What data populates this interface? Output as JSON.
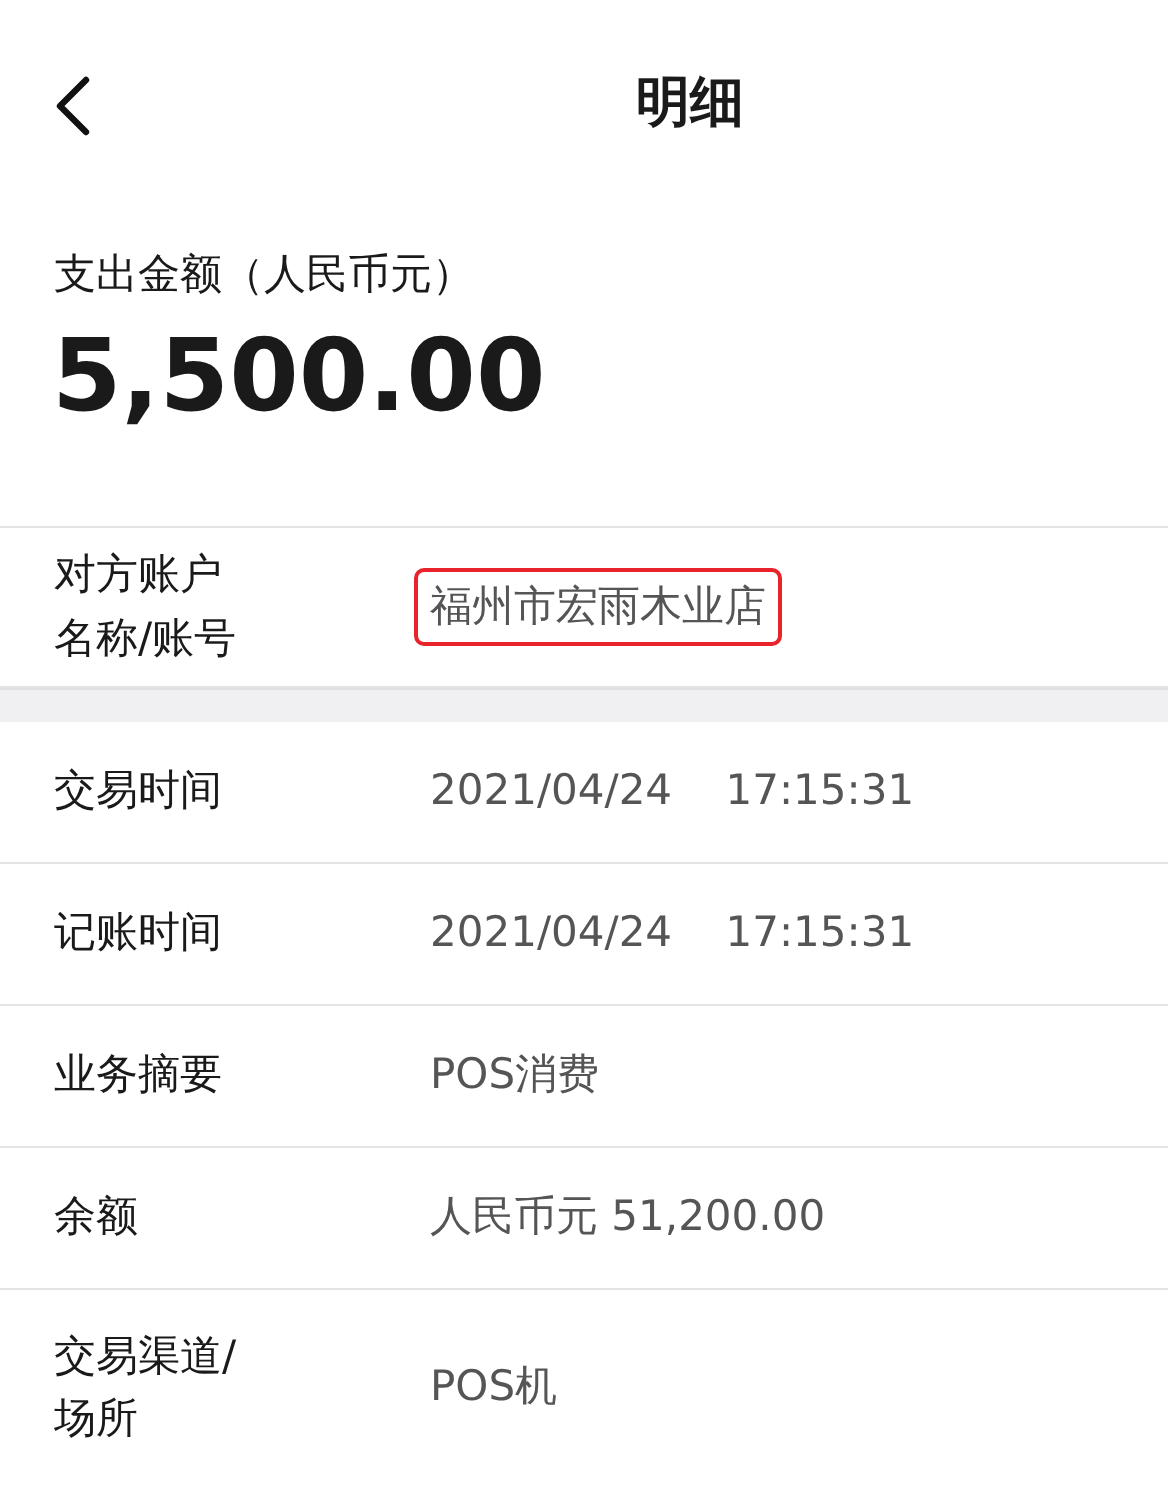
{
  "header": {
    "title": "明细"
  },
  "amount": {
    "label": "支出金额（人民币元）",
    "value": "5,500.00"
  },
  "groups": [
    [
      {
        "label": "对方账户名称/账号",
        "value": "福州市宏雨木业店",
        "highlighted": true
      }
    ],
    [
      {
        "label": "交易时间",
        "value": "2021/04/24    17:15:31",
        "highlighted": false
      },
      {
        "label": "记账时间",
        "value": "2021/04/24    17:15:31",
        "highlighted": false
      },
      {
        "label": "业务摘要",
        "value": "POS消费",
        "highlighted": false
      },
      {
        "label": "余额",
        "value": "人民币元 51,200.00",
        "highlighted": false
      },
      {
        "label": "交易渠道/场所",
        "value": "POS机",
        "highlighted": false
      }
    ]
  ]
}
